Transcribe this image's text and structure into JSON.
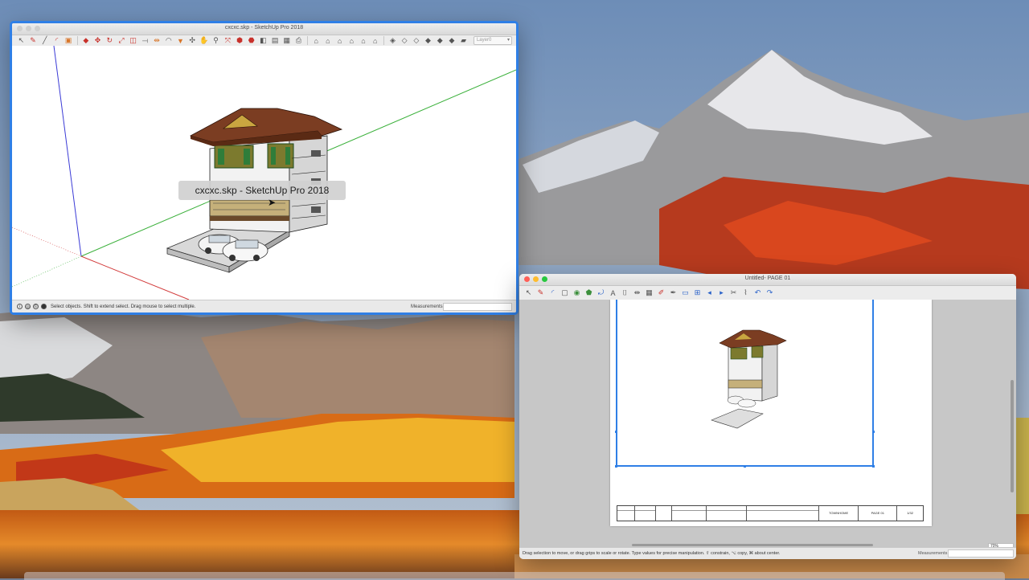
{
  "desktop": {
    "wallpaper": "macOS High Sierra mountain lake",
    "colors": {
      "sky": "#8fa2bb",
      "foliage": "#e8791c",
      "lake": "#d97a1c"
    }
  },
  "sketchup": {
    "window_title": "cxcxc.skp - SketchUp Pro 2018",
    "tooltip": "cxcxc.skp - SketchUp Pro 2018",
    "layer_placeholder": "Layer0",
    "status_message": "Select objects. Shift to extend select. Drag mouse to select multiple.",
    "measurements_label": "Measurements",
    "accent": "#2f7fe6"
  },
  "layout": {
    "window_title": "Untitled- PAGE 01",
    "status_message": "Drag selection to move, or drag grips to scale or rotate. Type values for precise manipulation. ⇧ constrain, ⌥ copy, ⌘ about center.",
    "measurements_label": "Measurements",
    "zoom": "70%",
    "titleblock": {
      "project": "TOWNHOME",
      "page": "PAGE 01",
      "sheet": "1/32"
    }
  }
}
